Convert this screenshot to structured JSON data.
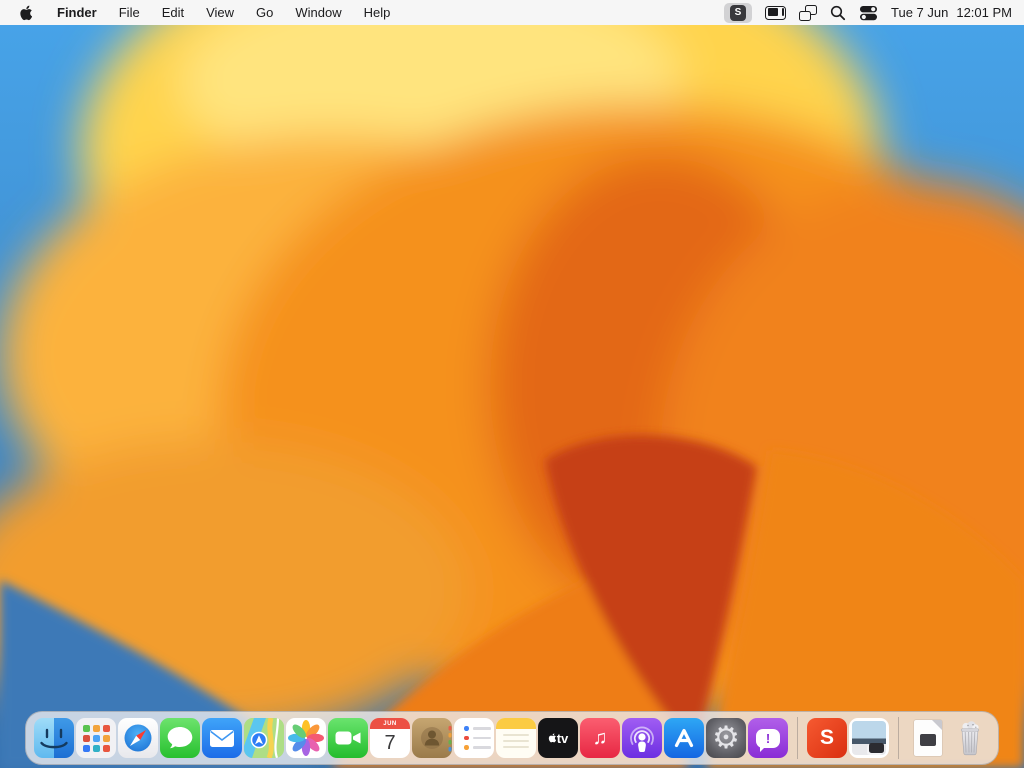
{
  "menubar": {
    "app_name": "Finder",
    "menus": [
      "File",
      "Edit",
      "View",
      "Go",
      "Window",
      "Help"
    ],
    "status": {
      "s_badge": "S",
      "date": "Tue 7 Jun",
      "time": "12:01 PM"
    }
  },
  "wallpaper": {
    "name": "macOS Ventura abstract bloom",
    "colors": {
      "sky_blue": "#47A3E8",
      "deep_blue": "#3572B0",
      "yellow": "#FFD44E",
      "orange": "#F5911E",
      "dark_orange": "#DE5C18",
      "red_petal": "#C63F16"
    }
  },
  "dock": {
    "items": [
      {
        "name": "Finder",
        "running": true
      },
      {
        "name": "Launchpad"
      },
      {
        "name": "Safari"
      },
      {
        "name": "Messages"
      },
      {
        "name": "Mail"
      },
      {
        "name": "Maps"
      },
      {
        "name": "Photos"
      },
      {
        "name": "FaceTime"
      },
      {
        "name": "Calendar"
      },
      {
        "name": "Contacts"
      },
      {
        "name": "Reminders"
      },
      {
        "name": "Notes"
      },
      {
        "name": "TV"
      },
      {
        "name": "Music"
      },
      {
        "name": "Podcasts"
      },
      {
        "name": "App Store"
      },
      {
        "name": "System Settings"
      },
      {
        "name": "Feedback Assistant"
      },
      {
        "name": "S App"
      },
      {
        "name": "Photo File"
      },
      {
        "name": "Document"
      },
      {
        "name": "Trash"
      }
    ],
    "calendar": {
      "month": "JUN",
      "day": "7"
    },
    "tv_label": "tv",
    "s_app_letter": "S",
    "feedback_mark": "!"
  }
}
